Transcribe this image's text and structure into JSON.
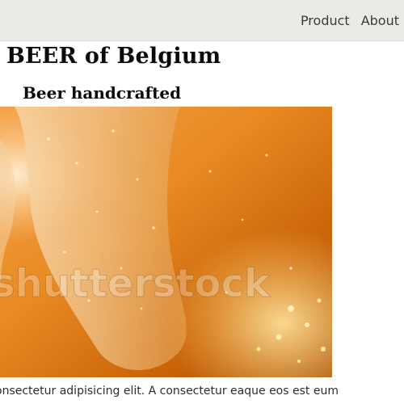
{
  "nav": {
    "items": [
      {
        "label": "Product"
      },
      {
        "label": "About"
      }
    ]
  },
  "header": {
    "title": "BEER of Belgium",
    "subtitle": "Beer handcrafted"
  },
  "hero": {
    "watermark": "shutterstock"
  },
  "content": {
    "paragraph_line1": "onsectetur adipisicing elit. A consectetur eaque eos est eum"
  },
  "colors": {
    "navbar_bg": "#ebebe6",
    "beer_light": "#ffb24a",
    "beer_mid": "#ec8a1b",
    "beer_dark": "#8d3d03"
  }
}
